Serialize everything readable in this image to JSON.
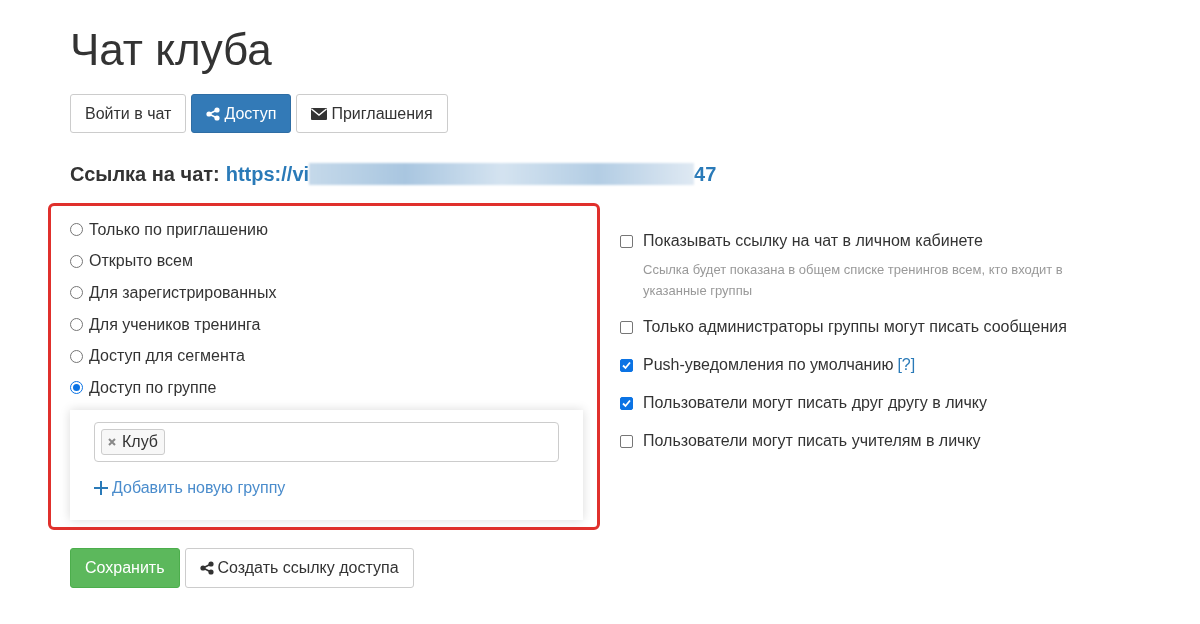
{
  "title": "Чат клуба",
  "tabs": [
    {
      "label": "Войти в чат",
      "kind": "plain",
      "selected": false
    },
    {
      "label": "Доступ",
      "kind": "share",
      "selected": true
    },
    {
      "label": "Приглашения",
      "kind": "invite",
      "selected": false
    }
  ],
  "chat_link": {
    "label": "Ссылка на чат:",
    "url_start": "https://vi",
    "url_end": "47"
  },
  "access_options": [
    {
      "label": "Только по приглашению",
      "selected": false
    },
    {
      "label": "Открыто всем",
      "selected": false
    },
    {
      "label": "Для зарегистрированных",
      "selected": false
    },
    {
      "label": "Для учеников тренинга",
      "selected": false
    },
    {
      "label": "Доступ для сегмента",
      "selected": false
    },
    {
      "label": "Доступ по группе",
      "selected": true
    }
  ],
  "groups": {
    "tags": [
      "Клуб"
    ],
    "add_link": "Добавить новую группу"
  },
  "settings": [
    {
      "label": "Показывать ссылку на чат в личном кабинете",
      "checked": false,
      "hint": "Ссылка будет показана в общем списке тренингов всем, кто входит в указанные группы"
    },
    {
      "label": "Только администраторы группы могут писать сообщения",
      "checked": false
    },
    {
      "label": "Push-уведомления по умолчанию",
      "checked": true,
      "help": "[?]"
    },
    {
      "label": "Пользователи могут писать друг другу в личку",
      "checked": true
    },
    {
      "label": "Пользователи могут писать учителям в личку",
      "checked": false
    }
  ],
  "actions": [
    {
      "label": "Сохранить",
      "kind": "primary"
    },
    {
      "label": "Создать ссылку доступа",
      "kind": "share"
    }
  ]
}
